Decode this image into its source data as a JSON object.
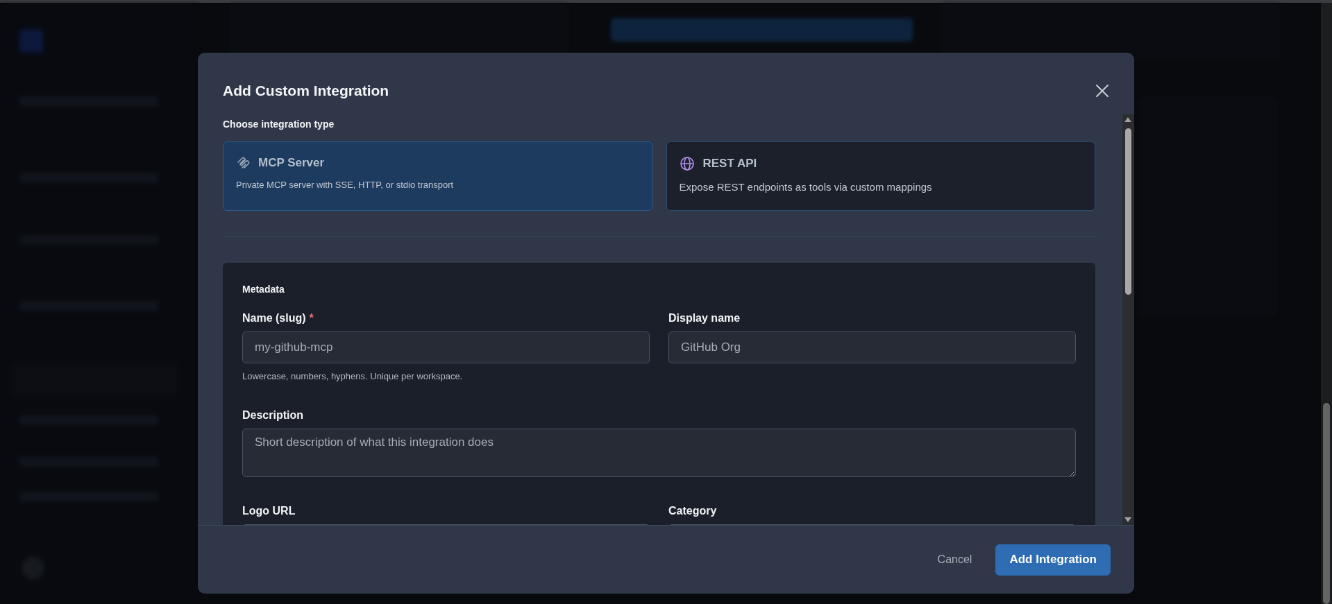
{
  "dialog": {
    "title": "Add Custom Integration",
    "type_label": "Choose integration type",
    "types": [
      {
        "kind": "mcp",
        "title": "MCP Server",
        "description": "Private MCP server with SSE, HTTP, or stdio transport",
        "selected": true
      },
      {
        "kind": "rest",
        "title": "REST API",
        "description": "Expose REST endpoints as tools via custom mappings",
        "selected": false
      }
    ],
    "metadata": {
      "heading": "Metadata",
      "fields": [
        {
          "kind": "text",
          "label": "Name (slug)",
          "required_mark": "*",
          "placeholder": "my-github-mcp",
          "hint": "Lowercase, numbers, hyphens. Unique per workspace."
        },
        {
          "kind": "text",
          "label": "Display name",
          "placeholder": "GitHub Org"
        },
        {
          "kind": "textarea",
          "label": "Description",
          "placeholder": "Short description of what this integration does"
        },
        {
          "kind": "text",
          "label": "Logo URL"
        },
        {
          "kind": "text",
          "label": "Category"
        }
      ]
    },
    "buttons": {
      "cancel": "Cancel",
      "submit": "Add Integration"
    }
  }
}
